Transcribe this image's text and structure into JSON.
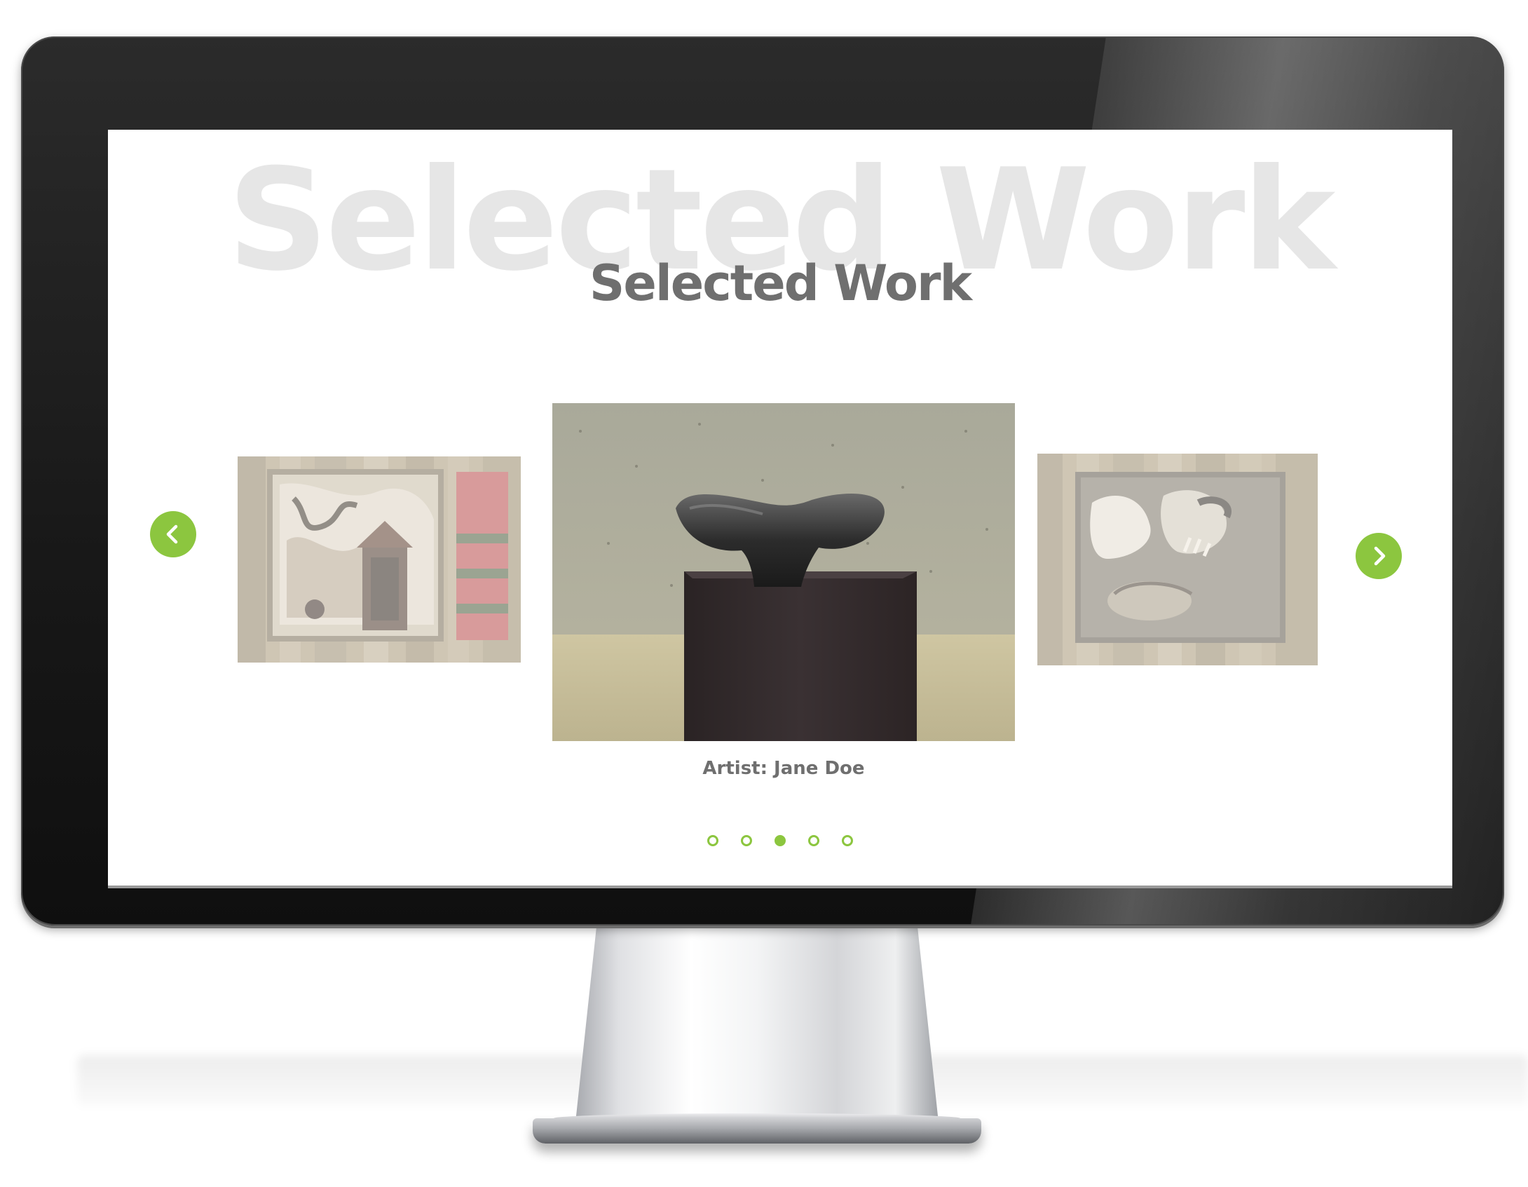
{
  "page": {
    "background_title": "Selected Work",
    "title": "Selected Work"
  },
  "slider": {
    "prev_icon": "chevron-left-icon",
    "next_icon": "chevron-right-icon",
    "caption": "Artist: Jane Doe",
    "dots_total": 5,
    "active_dot": 3,
    "slides": [
      {
        "name": "mixed-media-artwork-left",
        "icon": "artwork-image"
      },
      {
        "name": "whale-tail-sculpture",
        "icon": "sculpture-image"
      },
      {
        "name": "textured-painting-right",
        "icon": "artwork-image"
      }
    ]
  },
  "colors": {
    "accent": "#8cc63f",
    "title": "#6f6f6f",
    "background_title": "#e6e6e6",
    "monitor_bezel": "#1a1a1a"
  }
}
